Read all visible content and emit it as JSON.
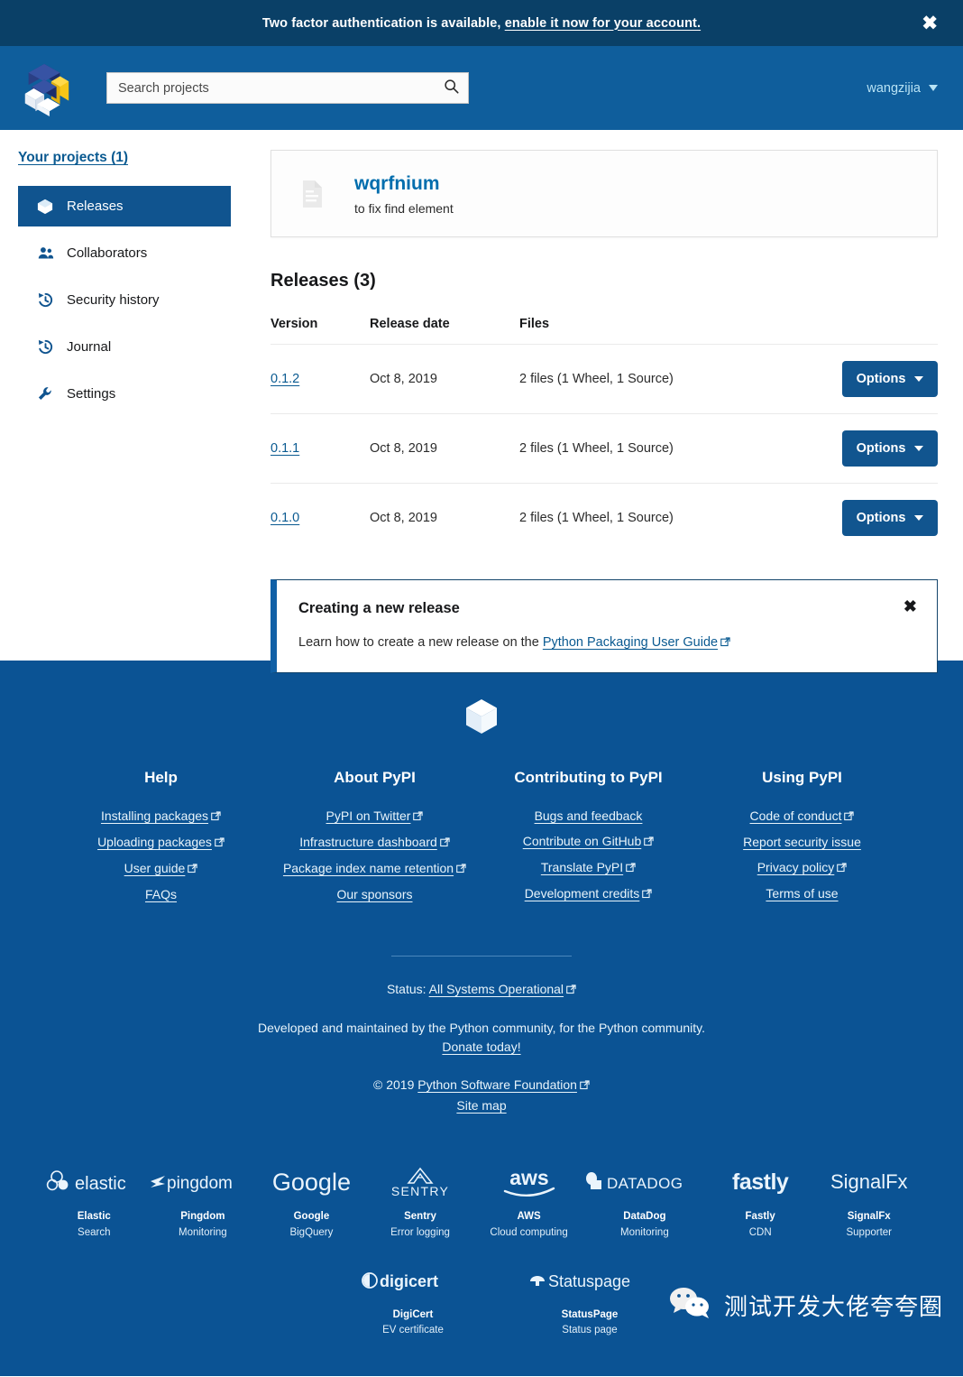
{
  "notification": {
    "text_before": "Two factor authentication is available, ",
    "link_text": "enable it now for your account.",
    "close_label": "✖"
  },
  "header": {
    "logo_name": "pypi-logo",
    "search_placeholder": "Search projects",
    "search_value": "",
    "username": "wangzijia"
  },
  "sidebar": {
    "your_projects": "Your projects (1)",
    "items": [
      {
        "label": "Releases",
        "icon": "package-icon",
        "active": true
      },
      {
        "label": "Collaborators",
        "icon": "users-icon",
        "active": false
      },
      {
        "label": "Security history",
        "icon": "history-icon",
        "active": false
      },
      {
        "label": "Journal",
        "icon": "history-icon",
        "active": false
      },
      {
        "label": "Settings",
        "icon": "wrench-icon",
        "active": false
      }
    ]
  },
  "project": {
    "name": "wqrfnium",
    "description": "to fix find element"
  },
  "releases": {
    "heading": "Releases (3)",
    "columns": [
      "Version",
      "Release date",
      "Files"
    ],
    "options_label": "Options",
    "rows": [
      {
        "version": "0.1.2",
        "date": "Oct 8, 2019",
        "files": "2 files (1 Wheel, 1 Source)"
      },
      {
        "version": "0.1.1",
        "date": "Oct 8, 2019",
        "files": "2 files (1 Wheel, 1 Source)"
      },
      {
        "version": "0.1.0",
        "date": "Oct 8, 2019",
        "files": "2 files (1 Wheel, 1 Source)"
      }
    ]
  },
  "callout": {
    "title": "Creating a new release",
    "body_before": "Learn how to create a new release on the ",
    "link_text": "Python Packaging User Guide",
    "close_label": "✖"
  },
  "footer": {
    "columns": [
      {
        "title": "Help",
        "links": [
          {
            "label": "Installing packages",
            "external": true
          },
          {
            "label": "Uploading packages",
            "external": true
          },
          {
            "label": "User guide",
            "external": true
          },
          {
            "label": "FAQs",
            "external": false
          }
        ]
      },
      {
        "title": "About PyPI",
        "links": [
          {
            "label": "PyPI on Twitter",
            "external": true
          },
          {
            "label": "Infrastructure dashboard",
            "external": true
          },
          {
            "label": "Package index name retention",
            "external": true
          },
          {
            "label": "Our sponsors",
            "external": false
          }
        ]
      },
      {
        "title": "Contributing to PyPI",
        "links": [
          {
            "label": "Bugs and feedback",
            "external": false
          },
          {
            "label": "Contribute on GitHub",
            "external": true
          },
          {
            "label": "Translate PyPI",
            "external": true
          },
          {
            "label": "Development credits",
            "external": true
          }
        ]
      },
      {
        "title": "Using PyPI",
        "links": [
          {
            "label": "Code of conduct",
            "external": true
          },
          {
            "label": "Report security issue",
            "external": false
          },
          {
            "label": "Privacy policy",
            "external": true
          },
          {
            "label": "Terms of use",
            "external": false
          }
        ]
      }
    ],
    "status_prefix": "Status: ",
    "status_link": "All Systems Operational",
    "developed_by": "Developed and maintained by the Python community, for the Python community.",
    "donate": "Donate today!",
    "copyright_prefix": "© 2019 ",
    "copyright_link": "Python Software Foundation",
    "site_map": "Site map"
  },
  "sponsors_row1": [
    {
      "logo": "elastic",
      "name": "Elastic",
      "role": "Search"
    },
    {
      "logo": "pingdom",
      "name": "Pingdom",
      "role": "Monitoring"
    },
    {
      "logo": "google",
      "name": "Google",
      "role": "BigQuery"
    },
    {
      "logo": "sentry",
      "name": "Sentry",
      "role": "Error logging"
    },
    {
      "logo": "aws",
      "name": "AWS",
      "role": "Cloud computing"
    },
    {
      "logo": "datadog",
      "name": "DataDog",
      "role": "Monitoring"
    },
    {
      "logo": "fastly",
      "name": "Fastly",
      "role": "CDN"
    },
    {
      "logo": "signalfx",
      "name": "SignalFx",
      "role": "Supporter"
    }
  ],
  "sponsors_row2": [
    {
      "logo": "digicert",
      "name": "DigiCert",
      "role": "EV certificate"
    },
    {
      "logo": "statuspage",
      "name": "StatusPage",
      "role": "Status page"
    }
  ],
  "watermark": {
    "text": "测试开发大佬夸夸圈"
  },
  "colors": {
    "banner_bg": "#0a4067",
    "header_bg": "#0f5e9c",
    "footer_bg": "#0b5394",
    "accent_button": "#11558f",
    "link": "#0a5a91",
    "project_name": "#006dad"
  }
}
